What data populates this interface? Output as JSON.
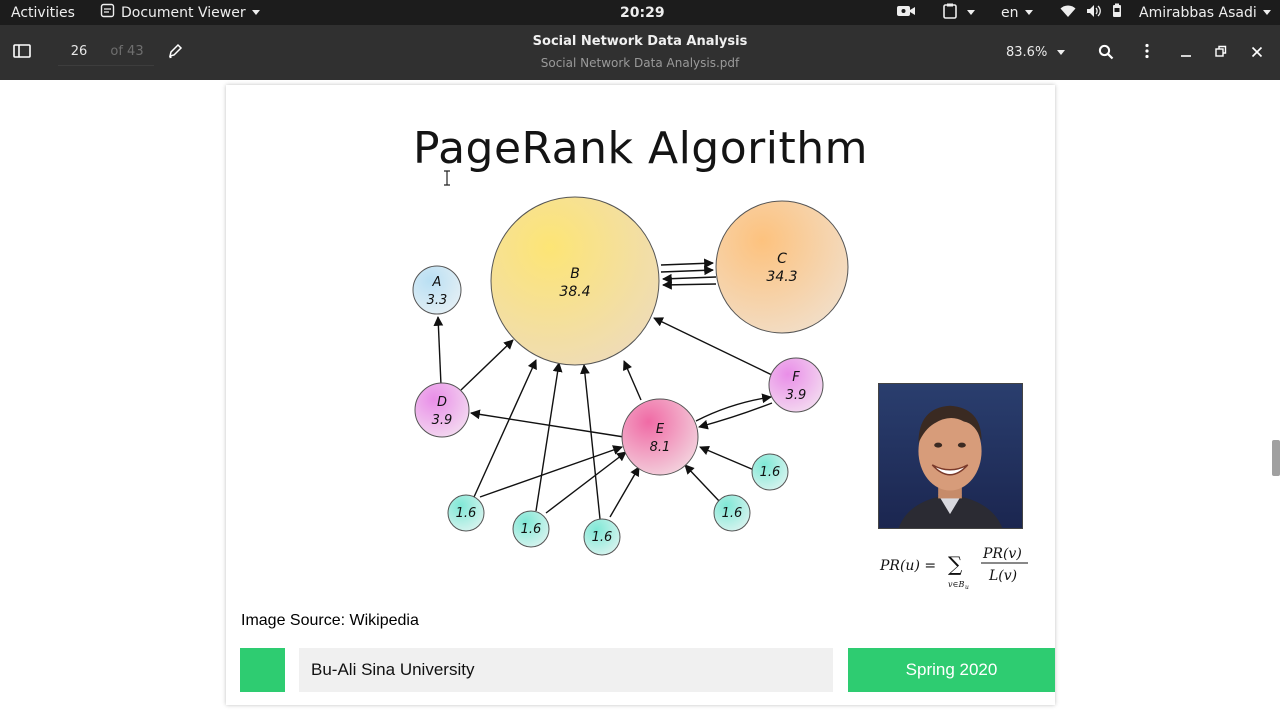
{
  "topbar": {
    "activities": "Activities",
    "app_name": "Document Viewer",
    "clock": "20:29",
    "language": "en",
    "user": "Amirabbas Asadi"
  },
  "header": {
    "page_number": "26",
    "page_of": "of 43",
    "title": "Social Network Data Analysis",
    "subtitle": "Social Network Data Analysis.pdf",
    "zoom": "83.6%"
  },
  "slide": {
    "title": "PageRank Algorithm",
    "source": "Image Source: Wikipedia",
    "university": "Bu-Ali Sina University",
    "season": "Spring 2020"
  },
  "graph": {
    "nodes": [
      {
        "id": "B",
        "label": "B",
        "score": "38.4"
      },
      {
        "id": "C",
        "label": "C",
        "score": "34.3"
      },
      {
        "id": "A",
        "label": "A",
        "score": "3.3"
      },
      {
        "id": "D",
        "label": "D",
        "score": "3.9"
      },
      {
        "id": "E",
        "label": "E",
        "score": "8.1"
      },
      {
        "id": "F",
        "label": "F",
        "score": "3.9"
      },
      {
        "id": "n1",
        "label": "",
        "score": "1.6"
      },
      {
        "id": "n2",
        "label": "",
        "score": "1.6"
      },
      {
        "id": "n3",
        "label": "",
        "score": "1.6"
      },
      {
        "id": "n4",
        "label": "",
        "score": "1.6"
      },
      {
        "id": "n5",
        "label": "",
        "score": "1.6"
      }
    ]
  },
  "formula": {
    "lhs": "PR(u) =",
    "sum": "∑",
    "sub": "v∈B",
    "sub_u": "u",
    "num": "PR(v)",
    "den": "L(v)"
  },
  "colors": {
    "green": "#2ecc71",
    "header_bg": "#303030",
    "topbar_bg": "#1c1c1c"
  }
}
